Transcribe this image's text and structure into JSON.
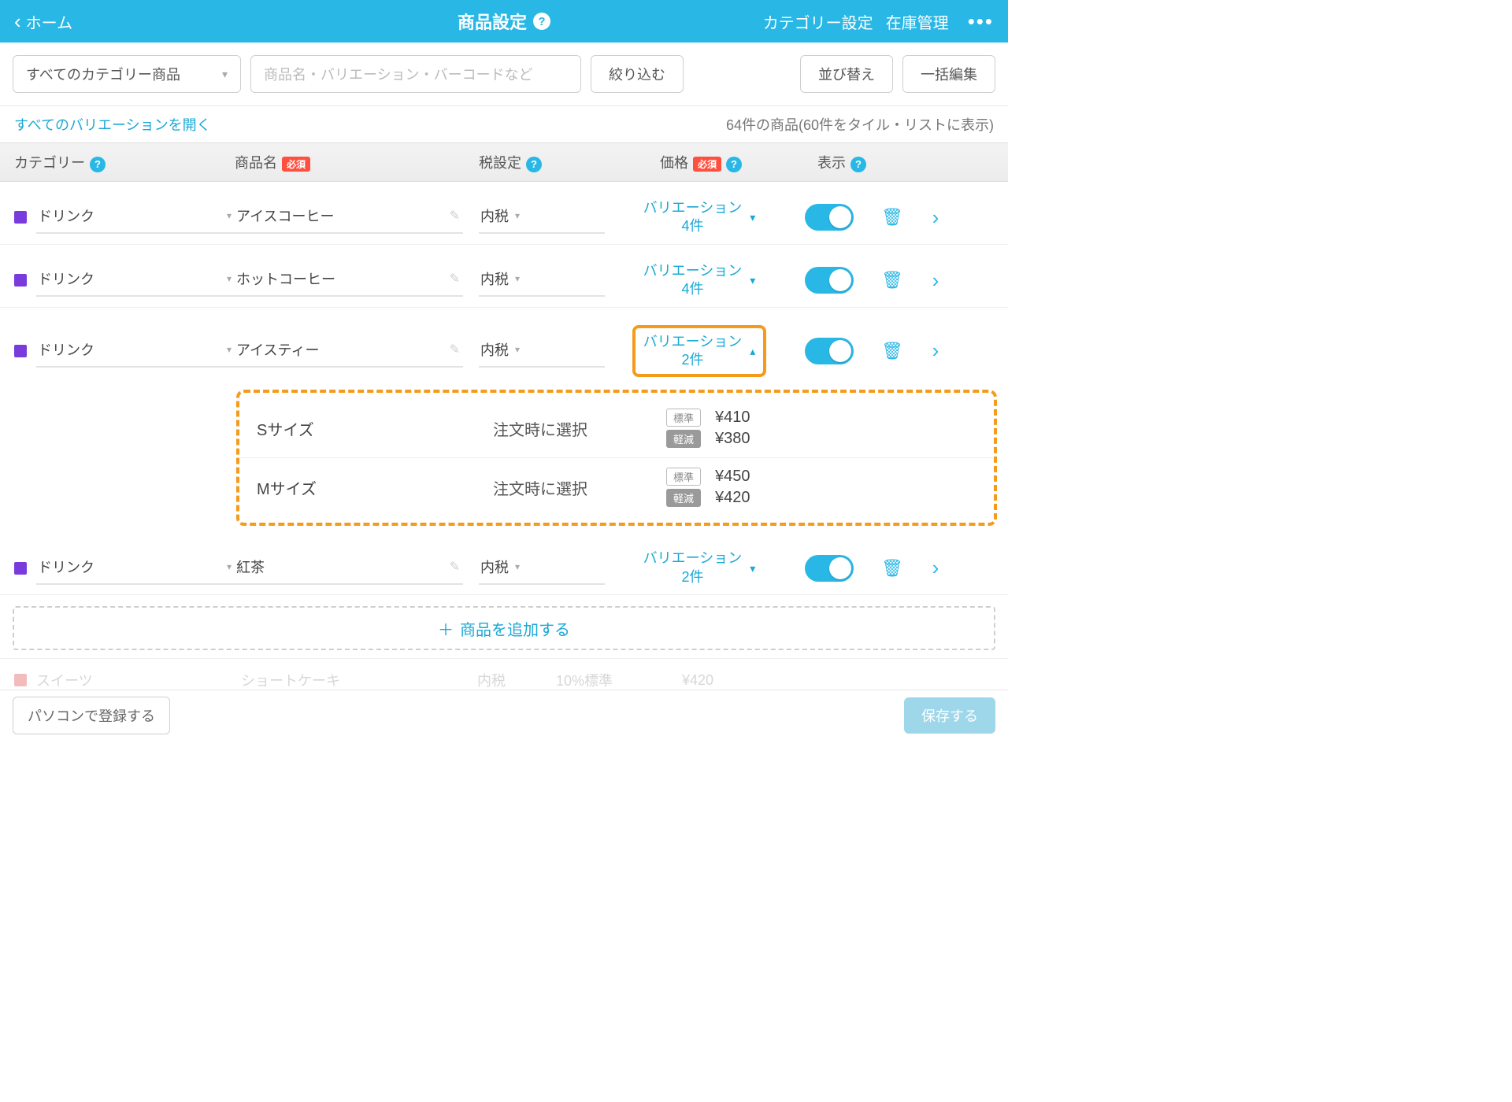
{
  "header": {
    "back_label": "ホーム",
    "title": "商品設定",
    "link_category": "カテゴリー設定",
    "link_stock": "在庫管理"
  },
  "toolbar": {
    "category_select": "すべてのカテゴリー商品",
    "search_placeholder": "商品名・バリエーション・バーコードなど",
    "filter_btn": "絞り込む",
    "sort_btn": "並び替え",
    "bulk_btn": "一括編集"
  },
  "subheader": {
    "expand_all": "すべてのバリエーションを開く",
    "count_text": "64件の商品(60件をタイル・リストに表示)"
  },
  "columns": {
    "category": "カテゴリー",
    "name": "商品名",
    "tax": "税設定",
    "price": "価格",
    "display": "表示",
    "required": "必須"
  },
  "rows": [
    {
      "category": "ドリンク",
      "name": "アイスコーヒー",
      "tax": "内税",
      "variation_label": "バリエーション",
      "variation_count": "4件",
      "expanded": false
    },
    {
      "category": "ドリンク",
      "name": "ホットコーヒー",
      "tax": "内税",
      "variation_label": "バリエーション",
      "variation_count": "4件",
      "expanded": false
    },
    {
      "category": "ドリンク",
      "name": "アイスティー",
      "tax": "内税",
      "variation_label": "バリエーション",
      "variation_count": "2件",
      "expanded": true,
      "variations": [
        {
          "name": "Sサイズ",
          "select_text": "注文時に選択",
          "std_tag": "標準",
          "std_price": "¥410",
          "red_tag": "軽減",
          "red_price": "¥380"
        },
        {
          "name": "Mサイズ",
          "select_text": "注文時に選択",
          "std_tag": "標準",
          "std_price": "¥450",
          "red_tag": "軽減",
          "red_price": "¥420"
        }
      ]
    },
    {
      "category": "ドリンク",
      "name": "紅茶",
      "tax": "内税",
      "variation_label": "バリエーション",
      "variation_count": "2件",
      "expanded": false
    }
  ],
  "add_product": "商品を追加する",
  "ghost": {
    "category": "スイーツ",
    "name": "ショートケーキ",
    "tax": "内税",
    "tax_extra": "10%標準",
    "price": "¥420"
  },
  "bottom": {
    "pc_register": "パソコンで登録する",
    "save": "保存する"
  }
}
